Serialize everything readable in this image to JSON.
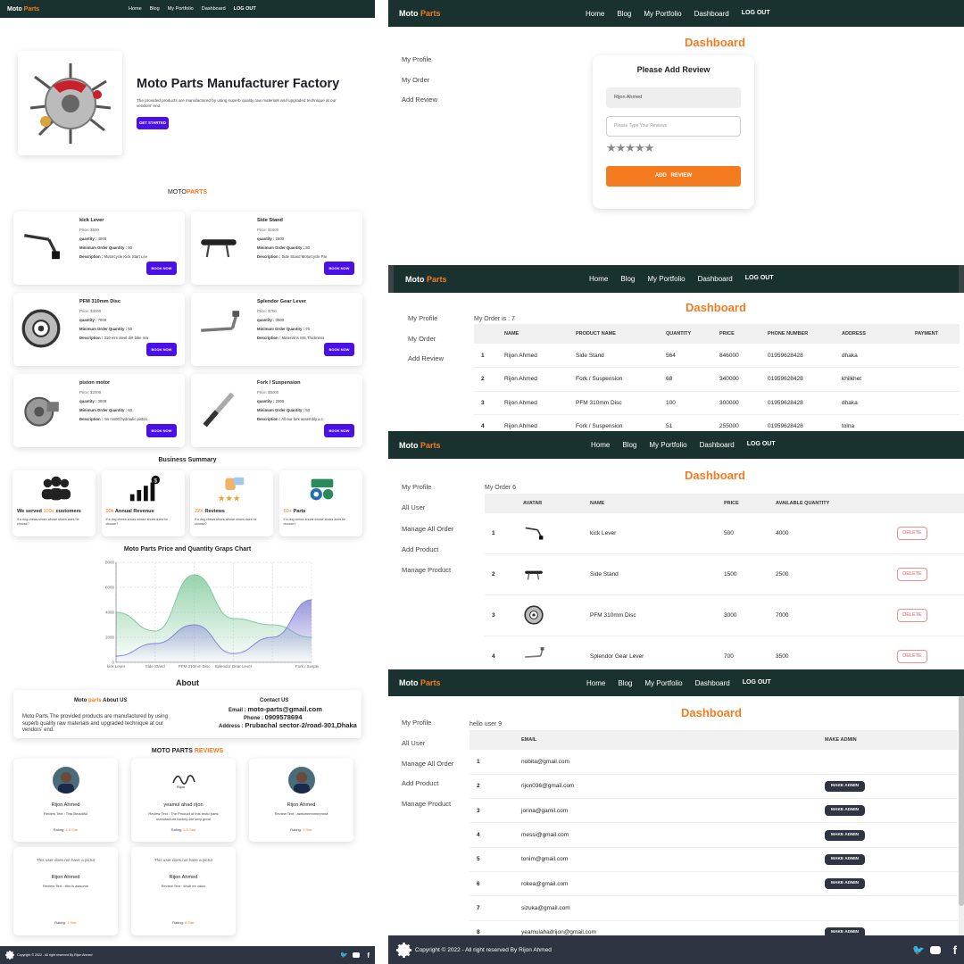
{
  "nav": {
    "brand_main": "Moto",
    "brand_accent": "Parts",
    "links": [
      "Home",
      "Blog",
      "My Portfolio",
      "Dashboard",
      "LOG OUT"
    ]
  },
  "home": {
    "hero_title": "Moto Parts Manufacturer Factory",
    "hero_text": "The provided products are manufactured by using superb quality raw materials and upgraded technique at our vendors' end.",
    "hero_button": "GET STARTED",
    "section_title_main": "MOTO",
    "section_title_accent": "PARTS",
    "products": [
      {
        "name": "kick Lever",
        "price": "Price: $500",
        "quantity": "4000",
        "min_order": "90",
        "description": "Motorcycle Kick Start Lev",
        "icon": "kick-lever-icon"
      },
      {
        "name": "Side Stand",
        "price": "Price: $1500",
        "quantity": "2500",
        "min_order": "80",
        "description": "Side Stand Motorcycle Par",
        "icon": "side-stand-icon"
      },
      {
        "name": "PFM 310mm Disc",
        "price": "Price: $3000",
        "quantity": "7000",
        "min_order": "50",
        "description": "310 mm steel dirt bike rea",
        "icon": "disc-icon"
      },
      {
        "name": "Splendor Gear Lever",
        "price": "Price: $700",
        "quantity": "3500",
        "min_order": "70",
        "description": "Material is MS,Thickness",
        "icon": "gear-lever-icon"
      },
      {
        "name": "piston motor",
        "price": "Price: $2000",
        "quantity": "3000",
        "min_order": "60",
        "description": "ms ms00 hydraulic piston",
        "icon": "piston-icon"
      },
      {
        "name": "Fork / Suspension",
        "price": "Price: $5000",
        "quantity": "2000",
        "min_order": "50",
        "description": "All our fork assembly a c",
        "icon": "fork-icon"
      }
    ],
    "labels": {
      "quantity": "quantity :",
      "min_order": "Minimum Order Quantity :",
      "description": "Description :",
      "book_now": "BOOK NOW"
    },
    "summary_title": "Business Summary",
    "summary": [
      {
        "num": "100+",
        "pre": "We served ",
        "post": " customers",
        "text": "If a dog chews shoes whose shoes does he choose?",
        "icon": "customers-icon"
      },
      {
        "num": "99k",
        "pre": "",
        "post": " Annual Revenue",
        "text": "If a dog chews shoes whose shoes does he choose?",
        "icon": "revenue-icon"
      },
      {
        "num": "22K",
        "pre": "",
        "post": " Reviews",
        "text": "If a dog chews shoes whose shoes does he choose?",
        "icon": "reviews-icon"
      },
      {
        "num": "50+",
        "pre": "",
        "post": " Parts",
        "text": "If a dog chews shoes whose shoes does he choose?",
        "icon": "parts-icon"
      }
    ],
    "chart_title": "Moto Parts Price and Quantity Graps Chart",
    "about_title": "About",
    "about_us_title_main": "Moto",
    "about_us_title_accent": "parts",
    "about_us_title_end": "About US",
    "about_text": "Moto Parts The provided products are manufactured by using superb quality raw materials and upgraded technique at our vendors' end.",
    "contact_title": "Contact US",
    "contact_email_label": "Email :",
    "contact_email": "moto-parts@gmail.com",
    "contact_phone_label": "Phone :",
    "contact_phone": "0909578694",
    "contact_address_label": "Address :",
    "contact_address": "Prubachal sector-2/road-301,Dhaka",
    "reviews_title_main": "MOTO PARTS",
    "reviews_title_accent": "REVIEWS",
    "reviews": [
      {
        "name": "Rijon Ahmed",
        "text": "Review Text : This Beautiful",
        "rating_label": "Rating:",
        "rating": "4.5 Star",
        "avatar": "person"
      },
      {
        "name": "yeamul ahad rijon",
        "text": "Review Text : The Product of this moto parts manufacture factory are very good",
        "rating_label": "Rating:",
        "rating": "5.5 Star",
        "avatar": "signature"
      },
      {
        "name": "Rijon Ahmed",
        "text": "Review Text : awsommmmmmma",
        "rating_label": "Rating:",
        "rating": "4 Star",
        "avatar": "person"
      },
      {
        "name": "Rijon Ahmed",
        "text": "Review Text : this is awsome",
        "rating_label": "Rating:",
        "rating": "3 Star",
        "avatar": "broken",
        "alt": "This user does not have a pictur"
      },
      {
        "name": "Rijon Ahmed",
        "text": "Review Text : khub ee valoo",
        "rating_label": "Rating:",
        "rating": "5 Star",
        "avatar": "broken",
        "alt": "This user does not have a pictur"
      }
    ],
    "footer_text": "Copyright © 2022 - All right reserved By Rijon Ahmed"
  },
  "chart_data": {
    "type": "area",
    "title": "Moto Parts Price and Quantity Graps Chart",
    "categories": [
      "kick Lever",
      "Side Stand",
      "PFM 310mm Disc",
      "Splendor Gear Lever",
      "piston motor",
      "Fork / Suspension"
    ],
    "x_tick_labels": [
      "kick Lever",
      "Side Stand",
      "PFM 310mm Disc",
      "Splendor Gear Lever",
      "",
      "Fork / Suspension"
    ],
    "ylim": [
      0,
      8000
    ],
    "yticks": [
      "0",
      "2000",
      "4000",
      "6000",
      "8000"
    ],
    "series": [
      {
        "name": "quantity",
        "values": [
          4000,
          2500,
          7000,
          3500,
          3000,
          2000
        ],
        "color": "#82ca9d"
      },
      {
        "name": "price",
        "values": [
          500,
          1500,
          3000,
          700,
          2000,
          5000
        ],
        "color": "#8884d8"
      }
    ],
    "grid": true
  },
  "review_panel": {
    "title": "Dashboard",
    "form_title": "Please Add Review",
    "name_value": "Rijon Ahmed",
    "review_placeholder": "Please Type Your Reviews",
    "stars": "★★★★★",
    "button": "ADD REVIEW",
    "sidebar": [
      "My Profile",
      "My Order",
      "Add Review"
    ]
  },
  "order_panel": {
    "title": "Dashboard",
    "count": "My Order is : 7",
    "sidebar": [
      "My Profile",
      "My Order",
      "Add Review"
    ],
    "columns": [
      "",
      "NAME",
      "PRODUCT NAME",
      "QUANTITY",
      "PRICE",
      "PHONE NUMBER",
      "ADDRESS",
      "PAYMENT"
    ],
    "rows": [
      [
        "1",
        "Rijon Ahmed",
        "Side Stand",
        "564",
        "846000",
        "01959628428",
        "dhaka"
      ],
      [
        "2",
        "Rijon Ahmed",
        "Fork / Suspension",
        "68",
        "340000",
        "01959628428",
        "khilkhet"
      ],
      [
        "3",
        "Rijon Ahmed",
        "PFM 310mm Disc",
        "100",
        "300000",
        "01959628428",
        "dhaka"
      ],
      [
        "4",
        "Rijon Ahmed",
        "Fork / Suspension",
        "51",
        "255000",
        "01959628428",
        "tolna"
      ]
    ]
  },
  "manage_panel": {
    "title": "Dashboard",
    "count": "My Order 6",
    "sidebar": [
      "My Profile",
      "All User",
      "Manage All Order",
      "Add Product",
      "Manage Product"
    ],
    "columns": [
      "",
      "AVATAR",
      "NAME",
      "PRICE",
      "AVAILABLE QUANTITY",
      ""
    ],
    "delete_label": "DELETE",
    "rows": [
      {
        "n": "1",
        "name": "kick Lever",
        "price": "500",
        "qty": "4000",
        "icon": "kick-lever-icon"
      },
      {
        "n": "2",
        "name": "Side Stand",
        "price": "1500",
        "qty": "2500",
        "icon": "side-stand-icon"
      },
      {
        "n": "3",
        "name": "PFM 310mm Disc",
        "price": "3000",
        "qty": "7000",
        "icon": "disc-icon"
      },
      {
        "n": "4",
        "name": "Splendor Gear Lever",
        "price": "700",
        "qty": "3500",
        "icon": "gear-lever-icon"
      }
    ]
  },
  "users_panel": {
    "title": "Dashboard",
    "count": "hello user 9",
    "sidebar": [
      "My Profile",
      "All User",
      "Manage All Order",
      "Add Product",
      "Manage Product"
    ],
    "columns": [
      "",
      "EMAIL",
      "MAKE ADMIN"
    ],
    "admin_label": "MAKE ADMIN",
    "rows": [
      {
        "n": "1",
        "email": "nobita@gmail.com",
        "admin": false
      },
      {
        "n": "2",
        "email": "rijon036@gmail.com",
        "admin": true
      },
      {
        "n": "3",
        "email": "jorina@gamil.com",
        "admin": true
      },
      {
        "n": "4",
        "email": "messi@gmail.com",
        "admin": true
      },
      {
        "n": "5",
        "email": "tonim@gmail.com",
        "admin": true
      },
      {
        "n": "6",
        "email": "rokea@gmail.com",
        "admin": true
      },
      {
        "n": "7",
        "email": "sizuka@gmail.com",
        "admin": false
      },
      {
        "n": "8",
        "email": "yeamulahadrijon@gmail.com",
        "admin": true
      }
    ],
    "footer_text": "Copyright © 2022 - All right reserved By Rijon Ahmed"
  }
}
